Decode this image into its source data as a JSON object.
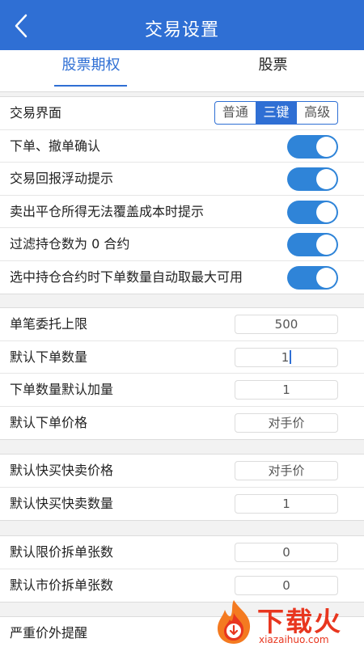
{
  "header": {
    "title": "交易设置"
  },
  "tabs": [
    {
      "label": "股票期权"
    },
    {
      "label": "股票"
    }
  ],
  "section1": {
    "trade_ui": {
      "label": "交易界面",
      "options": [
        "普通",
        "三键",
        "高级"
      ],
      "selected": "三键"
    },
    "toggles": [
      {
        "label": "下单、撤单确认",
        "on": true
      },
      {
        "label": "交易回报浮动提示",
        "on": true
      },
      {
        "label": "卖出平仓所得无法覆盖成本时提示",
        "on": true
      },
      {
        "label": "过滤持仓数为 0 合约",
        "on": true
      },
      {
        "label": "选中持仓合约时下单数量自动取最大可用",
        "on": true
      }
    ]
  },
  "section2": [
    {
      "label": "单笔委托上限",
      "value": "500"
    },
    {
      "label": "默认下单数量",
      "value": "1"
    },
    {
      "label": "下单数量默认加量",
      "value": "1"
    },
    {
      "label": "默认下单价格",
      "value": "对手价"
    }
  ],
  "section3": [
    {
      "label": "默认快买快卖价格",
      "value": "对手价"
    },
    {
      "label": "默认快买快卖数量",
      "value": "1"
    }
  ],
  "section4": [
    {
      "label": "默认限价拆单张数",
      "value": "0"
    },
    {
      "label": "默认市价拆单张数",
      "value": "0"
    }
  ],
  "section5": {
    "label": "严重价外提醒"
  },
  "watermark": {
    "text": "下载火",
    "url": "xiazaihuo.com"
  },
  "colors": {
    "primary": "#2f6fd4",
    "toggle_on": "#2f84d8",
    "watermark": "#e8361f"
  }
}
